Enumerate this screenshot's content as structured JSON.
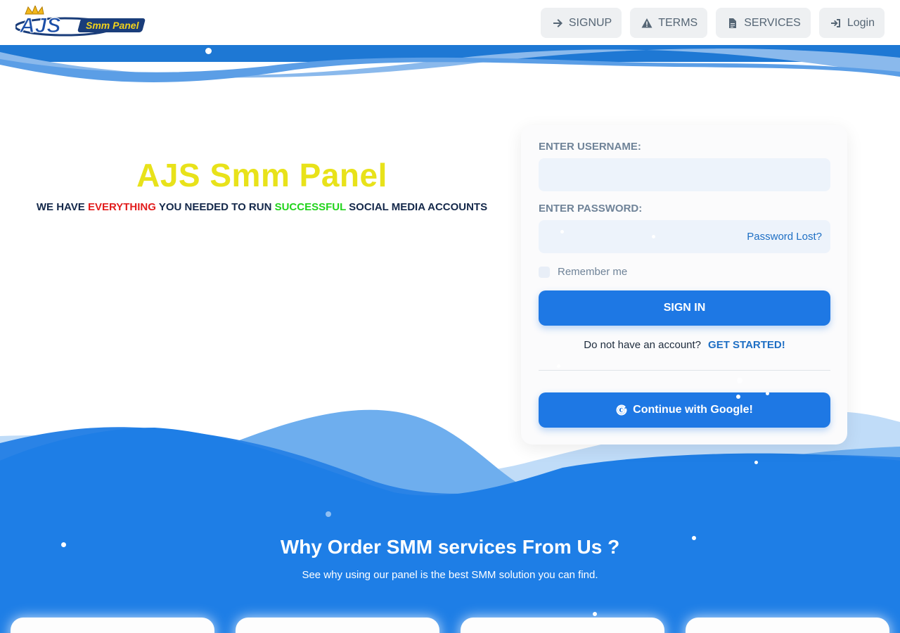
{
  "brand": {
    "logo_main": "AJS",
    "logo_sub": "Smm Panel"
  },
  "nav": {
    "items": [
      {
        "label": "SIGNUP",
        "icon": "arrow-right-icon"
      },
      {
        "label": "TERMS",
        "icon": "warning-icon"
      },
      {
        "label": "SERVICES",
        "icon": "file-icon"
      },
      {
        "label": "Login",
        "icon": "login-icon"
      }
    ]
  },
  "hero": {
    "title": "AJS Smm Panel",
    "sub_1": "WE HAVE",
    "sub_2": "EVERYTHING",
    "sub_3": "YOU NEEDED TO RUN",
    "sub_4": "SUCCESSFUL",
    "sub_5": "SOCIAL MEDIA ACCOUNTS"
  },
  "login": {
    "username_label": "ENTER USERNAME:",
    "username_value": "",
    "password_label": "ENTER PASSWORD:",
    "password_value": "",
    "password_lost": "Password Lost?",
    "remember_label": "Remember me",
    "signin_label": "SIGN IN",
    "no_account_text": "Do not have an account?",
    "get_started": "GET STARTED!",
    "google_label": "Continue with Google!"
  },
  "why": {
    "title": "Why Order SMM services From Us ?",
    "subtitle": "See why using our panel is the best SMM solution you can find."
  },
  "colors": {
    "accent": "#1e78e4",
    "title_yellow": "#e8e21a",
    "highlight_red": "#e21d1d",
    "highlight_green": "#22d31c"
  }
}
